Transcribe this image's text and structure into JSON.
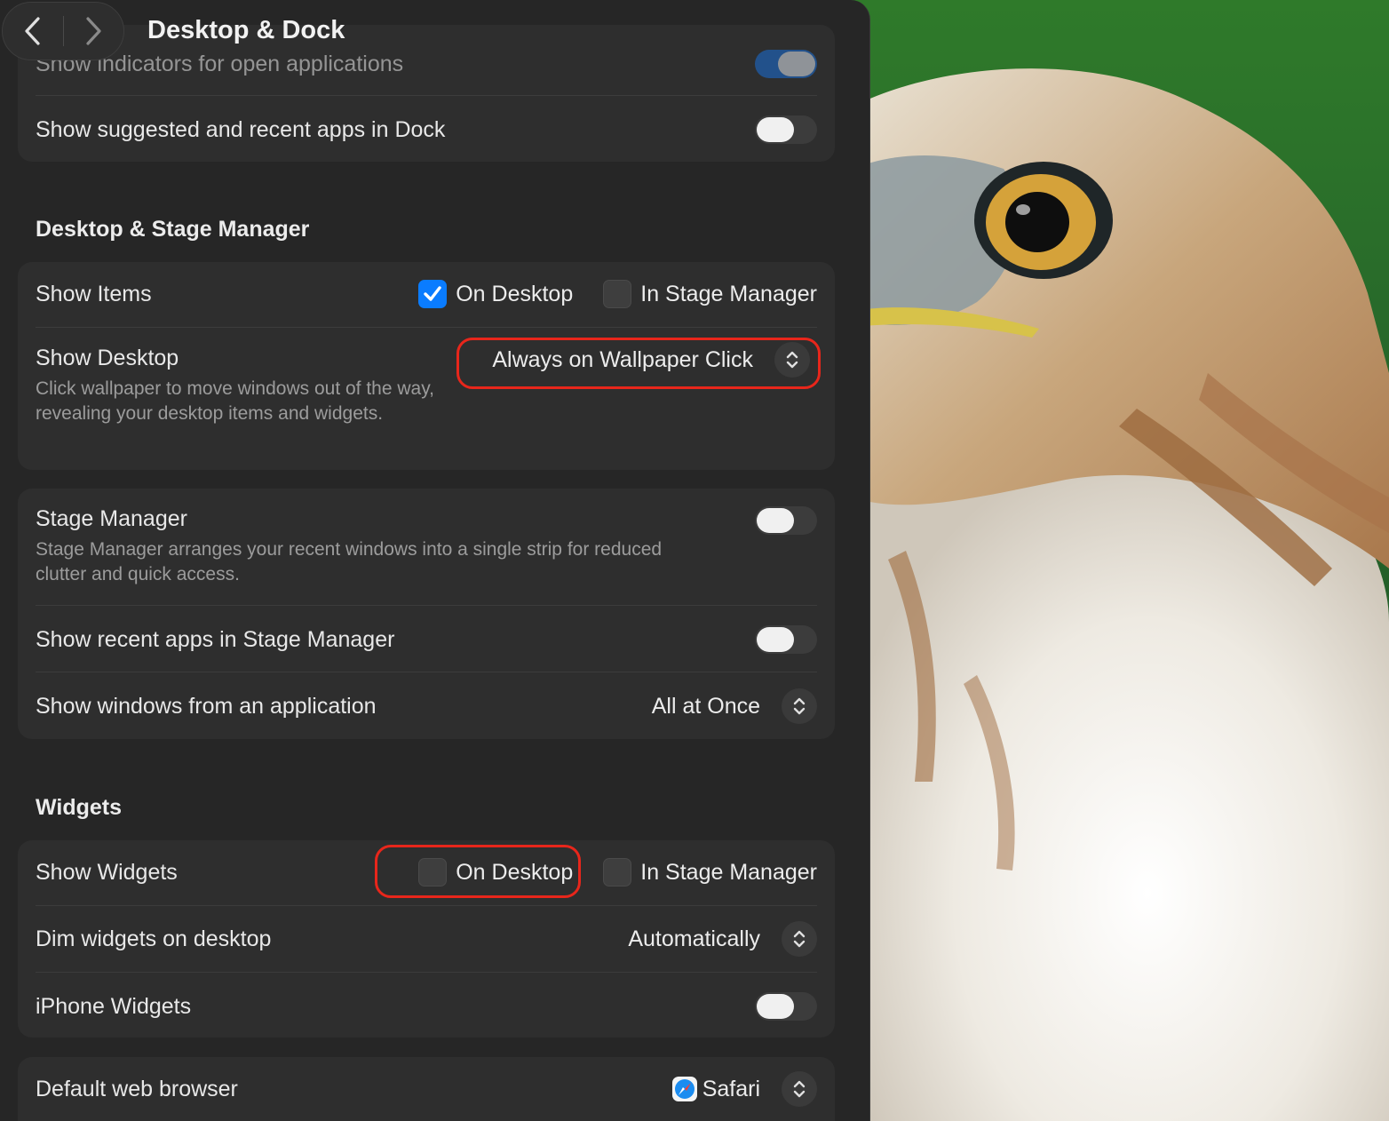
{
  "window": {
    "title": "Desktop & Dock"
  },
  "nav": {
    "back_icon": "chevron-left-icon",
    "forward_icon": "chevron-right-icon"
  },
  "dock": {
    "partial_row_label": "Show indicators for open applications",
    "partial_row_toggle": true,
    "suggested_apps_label": "Show suggested and recent apps in Dock",
    "suggested_apps_toggle": false
  },
  "desktop_stage": {
    "section_title": "Desktop & Stage Manager",
    "show_items": {
      "label": "Show Items",
      "on_desktop_label": "On Desktop",
      "on_desktop_checked": true,
      "in_stage_label": "In Stage Manager",
      "in_stage_checked": false
    },
    "show_desktop": {
      "label": "Show Desktop",
      "description": "Click wallpaper to move windows out of the way, revealing your desktop items and widgets.",
      "value": "Always on Wallpaper Click"
    },
    "stage_manager": {
      "label": "Stage Manager",
      "description": "Stage Manager arranges your recent windows into a single strip for reduced clutter and quick access.",
      "toggle": false
    },
    "recent_apps": {
      "label": "Show recent apps in Stage Manager",
      "toggle": false
    },
    "show_windows": {
      "label": "Show windows from an application",
      "value": "All at Once"
    }
  },
  "widgets": {
    "section_title": "Widgets",
    "show_widgets": {
      "label": "Show Widgets",
      "on_desktop_label": "On Desktop",
      "on_desktop_checked": false,
      "in_stage_label": "In Stage Manager",
      "in_stage_checked": false
    },
    "dim_widgets": {
      "label": "Dim widgets on desktop",
      "value": "Automatically"
    },
    "iphone_widgets": {
      "label": "iPhone Widgets",
      "toggle": false
    }
  },
  "browser": {
    "label": "Default web browser",
    "value": "Safari",
    "icon": "safari-compass-icon"
  },
  "colors": {
    "accent": "#0a7cff",
    "highlight": "#e8261b",
    "panel_bg": "#262626",
    "card_bg": "#2e2e2e"
  },
  "wallpaper": {
    "subject": "hawk-head-on-green-background"
  }
}
